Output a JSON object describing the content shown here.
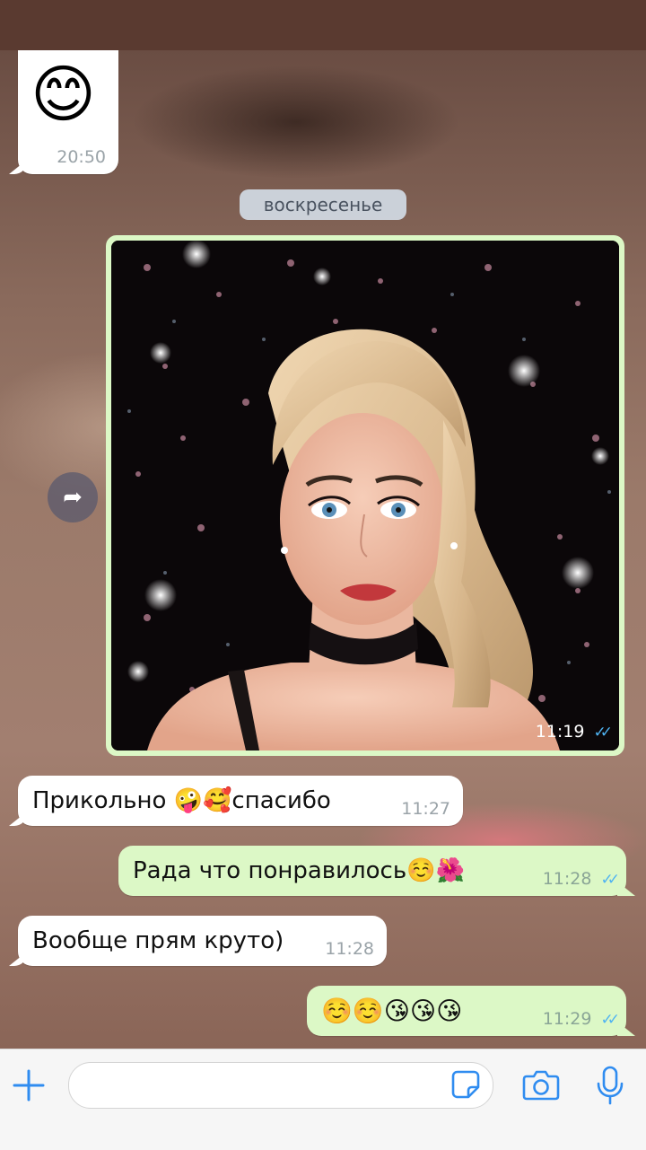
{
  "messages": {
    "m0": {
      "emoji": "😊",
      "time": "20:50"
    },
    "date_separator": "воскресенье",
    "photo": {
      "time": "11:19"
    },
    "m1": {
      "text": "Прикольно 🤪🥰спасибо",
      "time": "11:27"
    },
    "m2": {
      "text": "Рада что понравилось☺️🌺",
      "time": "11:28"
    },
    "m3": {
      "text": "Вообще прям круто)",
      "time": "11:28"
    },
    "m4": {
      "text": "☺️☺️😘😘😘",
      "time": "11:29"
    }
  },
  "icons": {
    "forward": "share-arrow",
    "add": "plus",
    "sticker": "sticker",
    "camera": "camera",
    "mic": "microphone",
    "read": "double-check"
  },
  "colors": {
    "incoming": "#ffffff",
    "outgoing": "#dcf8c6",
    "accent": "#2f8cf0",
    "read_check": "#4fb3f2"
  }
}
